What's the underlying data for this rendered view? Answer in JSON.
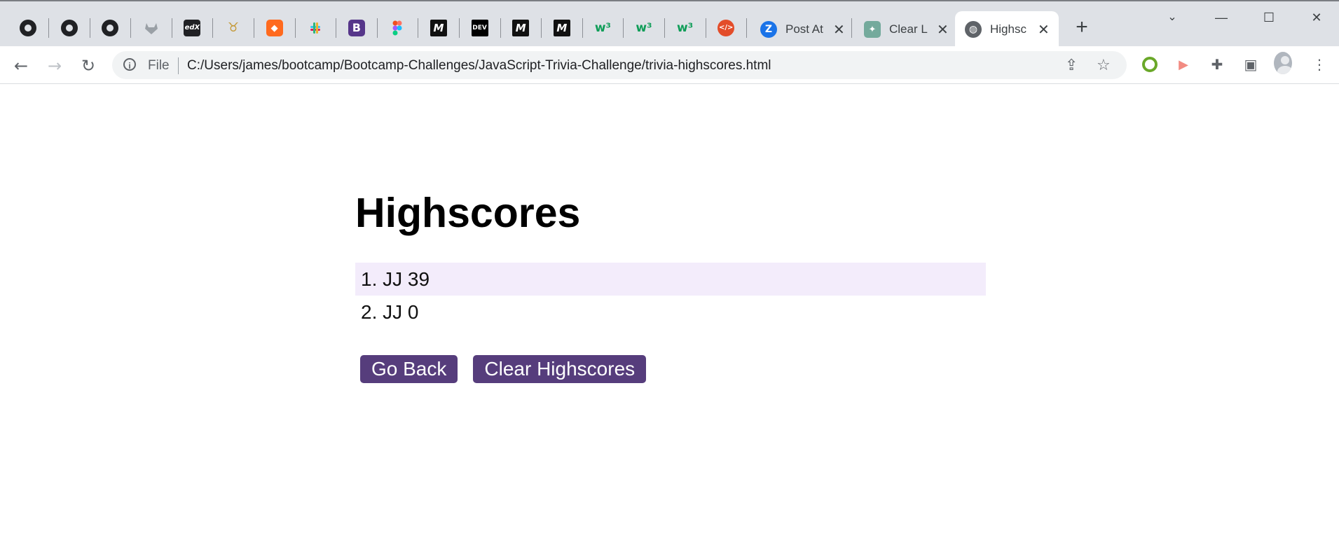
{
  "browser": {
    "pinned_tabs": [
      {
        "icon": "github-icon",
        "glyph": ""
      },
      {
        "icon": "github-icon",
        "glyph": ""
      },
      {
        "icon": "github-icon",
        "glyph": ""
      },
      {
        "icon": "gitlab-icon",
        "glyph": ""
      },
      {
        "icon": "edx-icon",
        "glyph": "edX"
      },
      {
        "icon": "fox-icon",
        "glyph": "♉"
      },
      {
        "icon": "hackerrank-icon",
        "glyph": "◆"
      },
      {
        "icon": "slack-icon",
        "glyph": ""
      },
      {
        "icon": "bootstrap-icon",
        "glyph": "B"
      },
      {
        "icon": "figma-icon",
        "glyph": ""
      },
      {
        "icon": "medium-icon",
        "glyph": "M"
      },
      {
        "icon": "dev-icon",
        "glyph": "DEV"
      },
      {
        "icon": "medium-icon",
        "glyph": "M"
      },
      {
        "icon": "medium-icon",
        "glyph": "M"
      },
      {
        "icon": "w3schools-icon",
        "glyph": "w³"
      },
      {
        "icon": "w3schools-icon",
        "glyph": "w³"
      },
      {
        "icon": "w3schools-icon",
        "glyph": "w³"
      },
      {
        "icon": "code-icon",
        "glyph": "</>"
      }
    ],
    "tabs": [
      {
        "title": "Post At",
        "icon": "zoom-icon",
        "glyph": "Z"
      },
      {
        "title": "Clear L",
        "icon": "chatgpt-icon",
        "glyph": "✦"
      },
      {
        "title": "Highsc",
        "icon": "globe-icon",
        "glyph": "◍",
        "active": true
      }
    ],
    "scheme_label": "File",
    "url": "C:/Users/james/bootcamp/Bootcamp-Challenges/JavaScript-Trivia-Challenge/trivia-highscores.html"
  },
  "page": {
    "title": "Highscores",
    "scores": [
      {
        "text": "1. JJ 39"
      },
      {
        "text": "2. JJ 0"
      }
    ],
    "go_back_label": "Go Back",
    "clear_label": "Clear Highscores"
  },
  "colors": {
    "button": "#563d7c",
    "first_row": "#f3ecfb"
  }
}
